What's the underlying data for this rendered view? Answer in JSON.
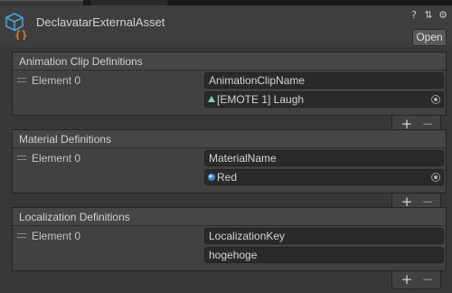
{
  "header": {
    "title": "DeclavatarExternalAsset",
    "open_label": "Open",
    "icons": [
      "help-icon",
      "preset-icon",
      "settings-icon"
    ]
  },
  "sections": [
    {
      "title": "Animation Clip Definitions",
      "element_label": "Element 0",
      "name_value": "AnimationClipName",
      "ref_value": "[EMOTE 1] Laugh",
      "ref_icon": "animation-clip-icon",
      "ref_is_object": true,
      "add_label": "+",
      "remove_label": "−"
    },
    {
      "title": "Material Definitions",
      "element_label": "Element 0",
      "name_value": "MaterialName",
      "ref_value": "Red",
      "ref_icon": "material-icon",
      "ref_is_object": true,
      "add_label": "+",
      "remove_label": "−"
    },
    {
      "title": "Localization Definitions",
      "element_label": "Element 0",
      "name_value": "LocalizationKey",
      "ref_value": "hogehoge",
      "ref_is_object": false,
      "add_label": "+",
      "remove_label": "−"
    }
  ],
  "colors": {
    "asset_icon_blue": "#4aa3d8",
    "asset_icon_orange": "#e07a2e",
    "clip_icon": "#7fd3b6",
    "material_icon": "#3d8ccf"
  }
}
